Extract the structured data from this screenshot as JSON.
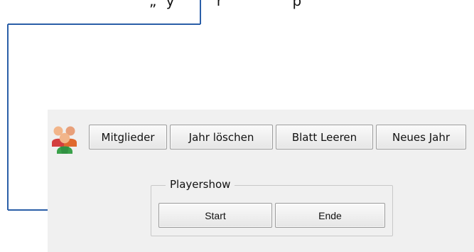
{
  "caption": {
    "visible_text": "„  y         r               p"
  },
  "toolbar": {
    "icon": "people-group-icon",
    "buttons": [
      {
        "label": "Mitglieder"
      },
      {
        "label": "Jahr löschen"
      },
      {
        "label": "Blatt Leeren"
      },
      {
        "label": "Neues Jahr"
      }
    ]
  },
  "playershow": {
    "legend": "Playershow",
    "start_label": "Start",
    "end_label": "Ende"
  },
  "colors": {
    "callout_blue": "#2b5fa8",
    "panel_bg": "#f0f0f0",
    "button_border": "#9c9c9c"
  }
}
